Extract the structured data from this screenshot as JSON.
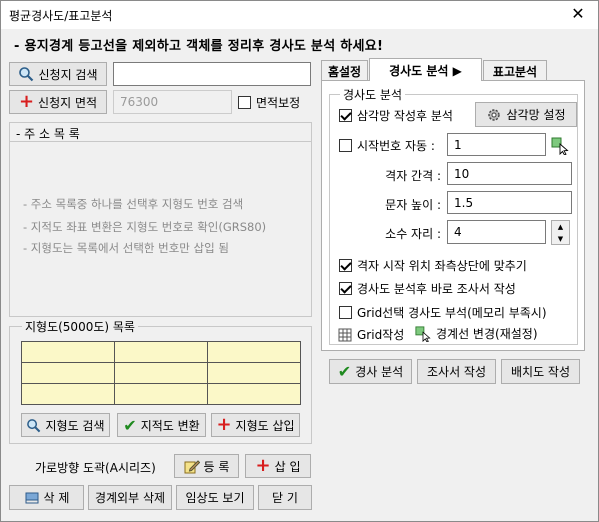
{
  "window": {
    "title": "평균경사도/표고분석",
    "close_glyph": "✕"
  },
  "instruction": "- 용지경계 등고선을 제외하고 객체를 정리후 경사도 분석 하세요!",
  "left": {
    "search_button": "신청지 검색",
    "search_value": "",
    "area_button": "신청지 면적",
    "area_value": "76300",
    "area_correction_label": "면적보정",
    "area_correction_checked": false,
    "address_group": {
      "title": "- 주 소 목 록",
      "hints": [
        "- 주소 목록중 하나를 선택후 지형도 번호 검색",
        "- 지적도 좌표 변환은 지형도 번호로 확인(GRS80)",
        "- 지형도는 목록에서 선택한 번호만 삽입 됨"
      ]
    },
    "map_group": {
      "title": "지형도(5000도) 목록",
      "grid_rows": 3,
      "grid_cols": 3,
      "grid_color": "#fbf8c8",
      "buttons": [
        "지형도 검색",
        "지적도 변환",
        "지형도 삽입"
      ]
    },
    "sheet_label": "가로방향 도곽(A시리즈)",
    "register_button": "등 록",
    "insert_button": "삽 입",
    "bottom_buttons": [
      "삭 제",
      "경계외부 삭제",
      "임상도 보기",
      "닫 기"
    ]
  },
  "tabs": [
    "홈설정",
    "경사도 분석 ▶",
    "표고분석"
  ],
  "active_tab": 1,
  "slope": {
    "group_title": "경사도 분석",
    "triangle_after_label": "삼각망 작성후 분석",
    "triangle_after_checked": true,
    "triangle_settings_button": "삼각망 설정",
    "auto_start_label": "시작번호 자동 :",
    "auto_start_checked": false,
    "auto_start_value": "1",
    "grid_spacing_label": "격자 간격 :",
    "grid_spacing_value": "10",
    "text_height_label": "문자 높이 :",
    "text_height_value": "1.5",
    "decimal_label": "소수 자리 :",
    "decimal_value": "4",
    "align_grid_label": "격자 시작 위치 좌측상단에 맞추기",
    "align_grid_checked": true,
    "survey_after_label": "경사도 분석후 바로 조사서 작성",
    "survey_after_checked": true,
    "grid_select_label": "Grid선택 경사도 부석(메모리 부족시)",
    "grid_select_checked": false,
    "grid_create_label": "Grid작성",
    "boundary_change_label": "경계선 변경(재설정)"
  },
  "actions": [
    "경사 분석",
    "조사서 작성",
    "배치도 작성"
  ],
  "colors": {
    "accent_green": "#1f8a1f",
    "accent_red": "#d81e1e",
    "grid_fill": "#fbf8c8"
  }
}
